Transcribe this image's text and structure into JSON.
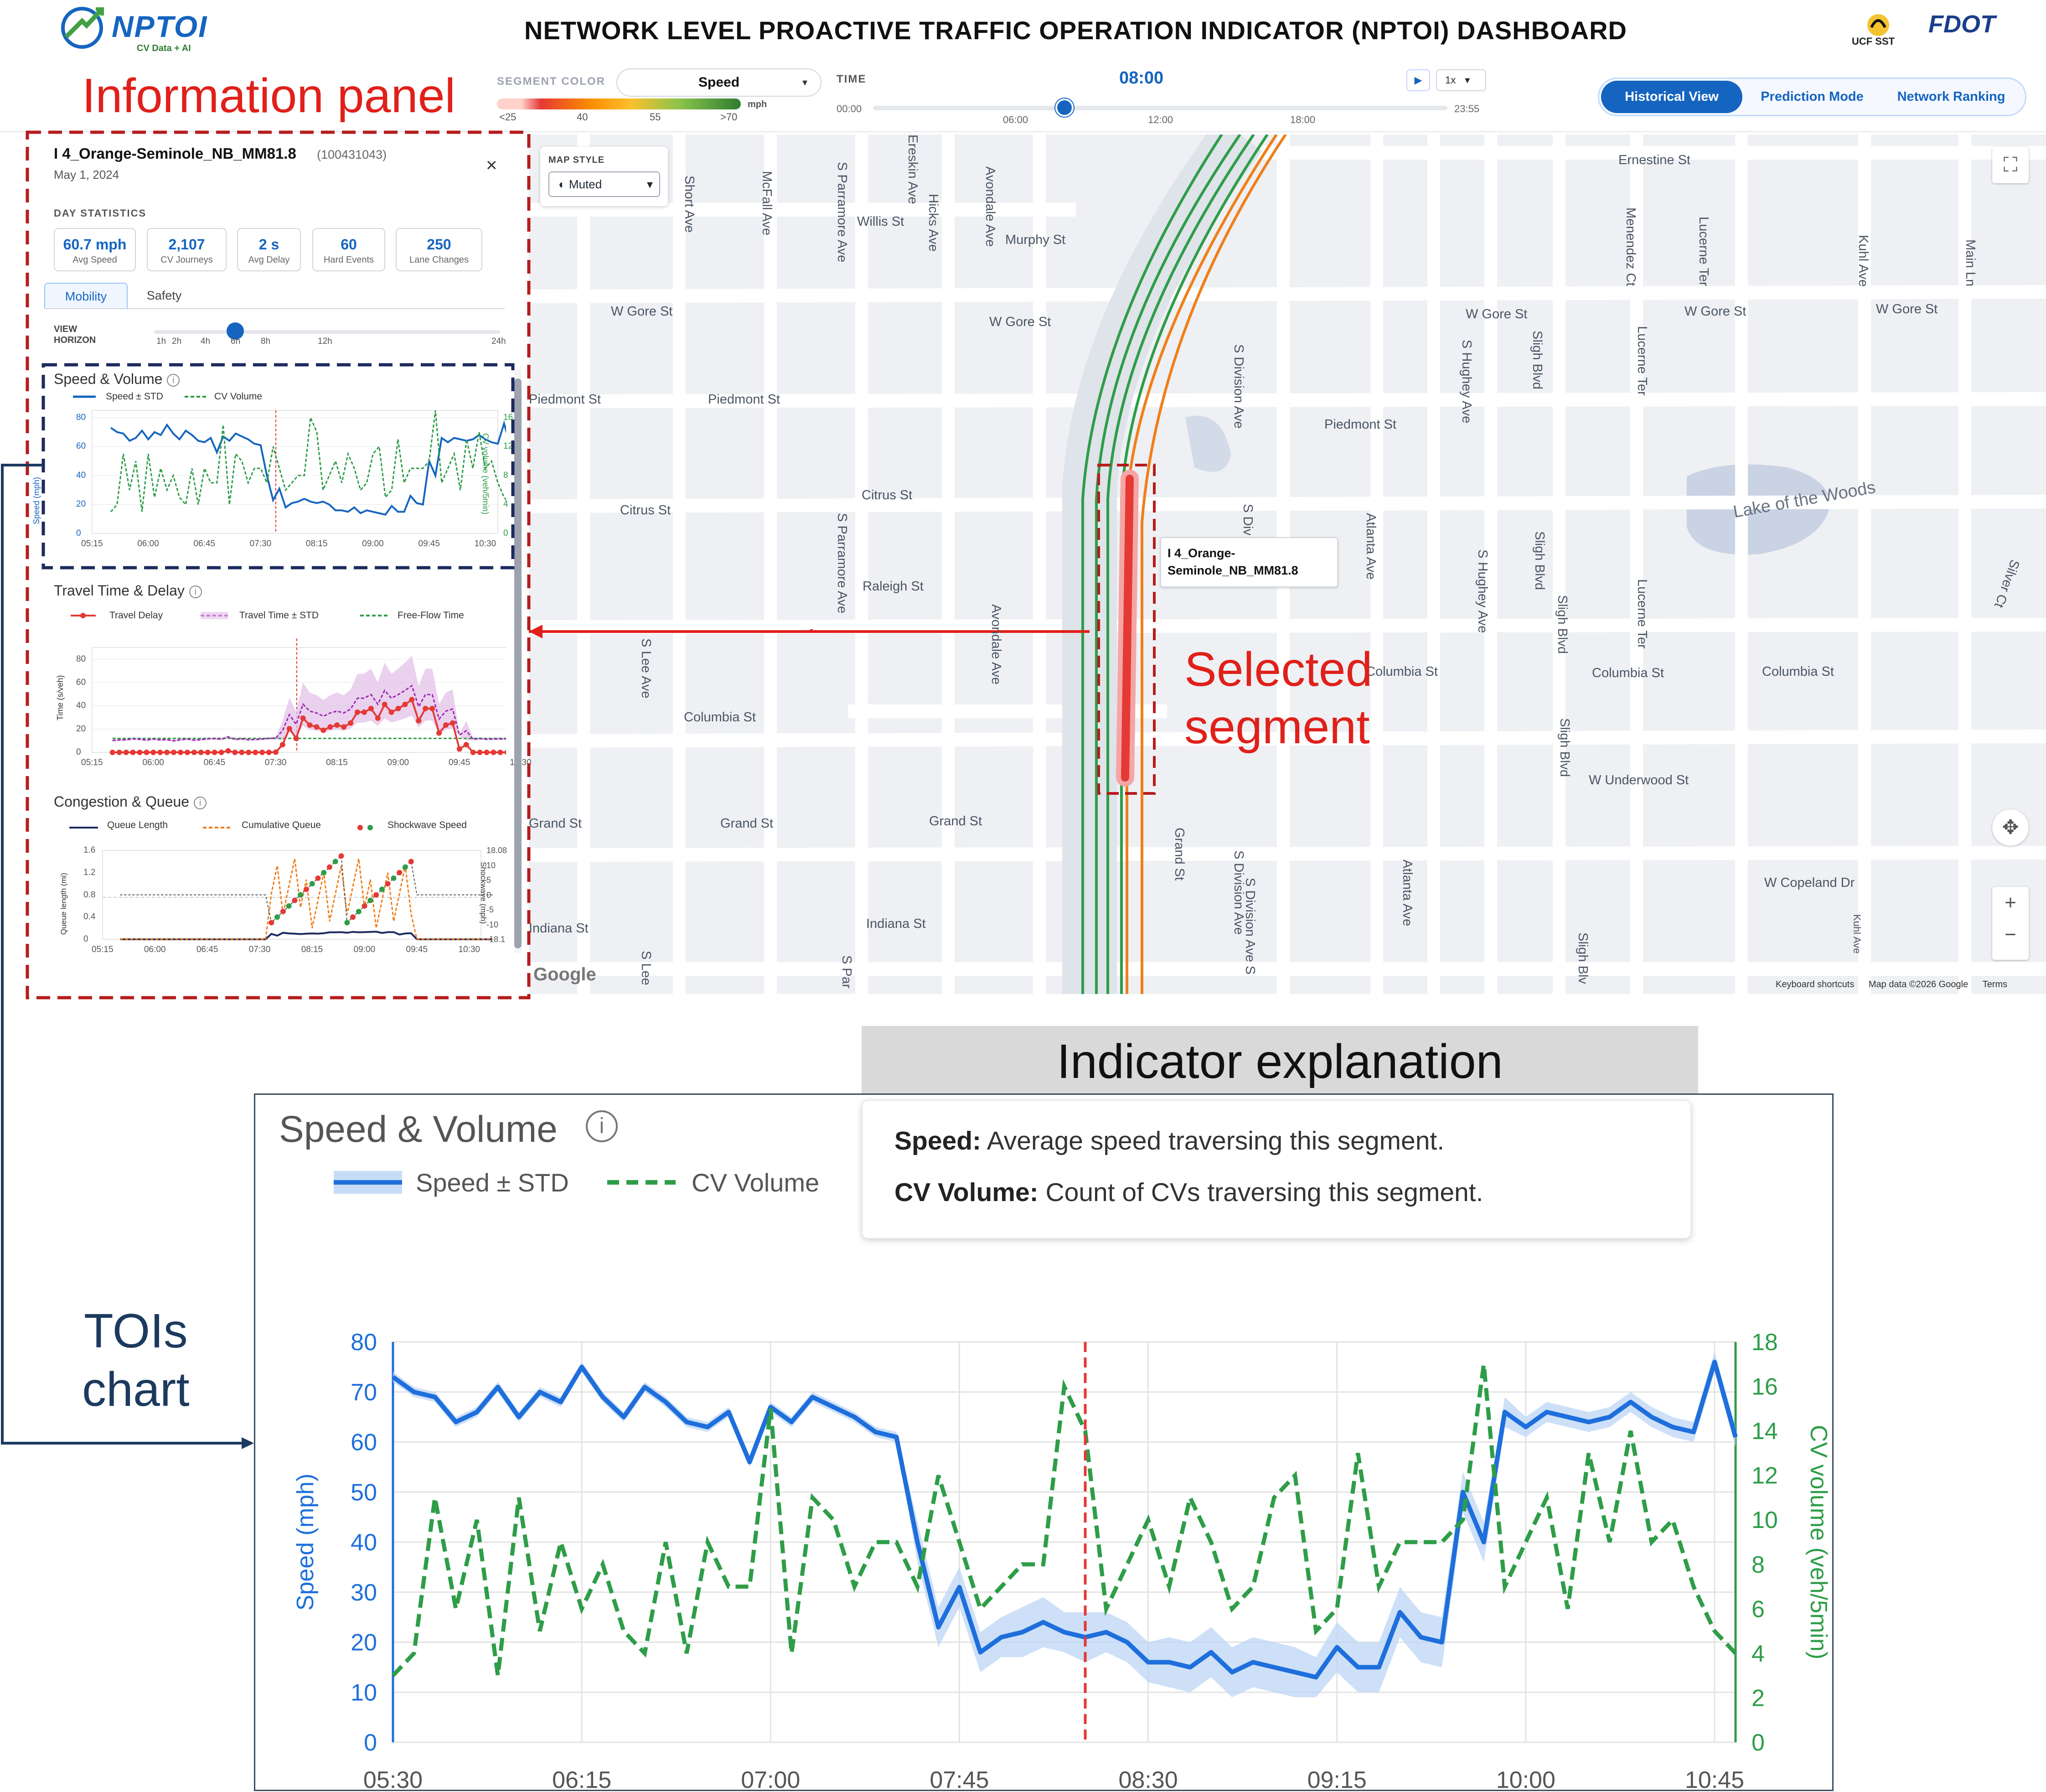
{
  "header": {
    "logo_text": "NPTOI",
    "logo_tagline": "CV Data + AI",
    "title": "NETWORK LEVEL PROACTIVE TRAFFIC OPERATION INDICATOR (NPTOI) DASHBOARD",
    "partner_ucf": "UCF SST",
    "partner_fdot": "FDOT"
  },
  "toolbar": {
    "segment_color_label": "SEGMENT COLOR",
    "segment_color_value": "Speed",
    "color_scale_ticks": [
      "<25",
      "40",
      "55",
      ">70"
    ],
    "color_scale_unit": "mph",
    "time_label": "TIME",
    "time_value": "08:00",
    "time_start": "00:00",
    "time_end": "23:55",
    "time_ticks": [
      "06:00",
      "12:00",
      "18:00"
    ],
    "time_progress": 0.333,
    "play_icon": "play-icon",
    "playback_speed": "1x",
    "modes": [
      "Historical View",
      "Prediction Mode",
      "Network Ranking"
    ],
    "active_mode": "Historical View"
  },
  "map": {
    "map_style_label": "MAP STYLE",
    "map_style_value": "◐ Muted",
    "streets": [
      "Ernestine St",
      "Short Ave",
      "McFall Ave",
      "S Parramore Ave",
      "Willis St",
      "Ereskin Ave",
      "Hicks Ave",
      "Avondale Ave",
      "Murphy St",
      "W Gore St",
      "W Gore St",
      "W Gore St",
      "W Gore St",
      "W Gore St",
      "Menendez Ct",
      "Lucerne Ter",
      "Kuhl Ave",
      "Main Ln",
      "Piedmont St",
      "Piedmont St",
      "Piedmont St",
      "S Division Ave",
      "S Hughey Ave",
      "Sligh Blvd",
      "Lucerne Ter",
      "Citrus St",
      "Citrus St",
      "Lake of the Woods",
      "S Parramore Ave",
      "Raleigh St",
      "Avondale Ave",
      "S Lee Ave",
      "S Hughey Ave",
      "Atlanta Ave",
      "Sligh Blvd",
      "Lucerne Ter",
      "Silver Ct",
      "Columbia St",
      "Columbia St",
      "Columbia St",
      "Columbia St",
      "Sligh Blvd",
      "W Underwood St",
      "Grand St",
      "Grand St",
      "Grand St",
      "Grand St",
      "W Copeland Dr",
      "Indiana St",
      "Indiana St",
      "S Lee",
      "S Par",
      "S Division Ave S",
      "Atlanta Ave",
      "Sligh Blv",
      "Kuhl Ave",
      "Sligh Blvd",
      "S Division Ave",
      "S Div"
    ],
    "selected_segment_tooltip": "I 4_Orange-Seminole_NB_MM81.8",
    "attribution": [
      "Keyboard shortcuts",
      "Map data ©2026 Google",
      "Terms"
    ],
    "google_logo": "Google"
  },
  "panel": {
    "segment_name": "I 4_Orange-Seminole_NB_MM81.8",
    "segment_id": "(100431043)",
    "date": "May 1, 2024",
    "day_statistics_label": "DAY STATISTICS",
    "stats": [
      {
        "value": "60.7 mph",
        "label": "Avg Speed"
      },
      {
        "value": "2,107",
        "label": "CV Journeys"
      },
      {
        "value": "2 s",
        "label": "Avg Delay"
      },
      {
        "value": "60",
        "label": "Hard Events"
      },
      {
        "value": "250",
        "label": "Lane Changes"
      }
    ],
    "tabs": [
      "Mobility",
      "Safety"
    ],
    "active_tab": "Mobility",
    "view_horizon_label": "VIEW HORIZON",
    "view_horizon_ticks": [
      "1h",
      "2h",
      "4h",
      "6h",
      "8h",
      "12h",
      "24h"
    ],
    "view_horizon_value": "6h"
  },
  "small_charts": {
    "speed_volume": {
      "title": "Speed & Volume",
      "legend": [
        "Speed ± STD",
        "CV Volume"
      ],
      "ylabel_left": "Speed (mph)",
      "ylabel_right": "CV volume (veh/5min)",
      "y_ticks_left": [
        "80",
        "60",
        "40",
        "20",
        "0"
      ],
      "y_ticks_right": [
        "16",
        "12",
        "8",
        "4",
        "0"
      ],
      "x_ticks": [
        "05:15",
        "06:00",
        "06:45",
        "07:30",
        "08:15",
        "09:00",
        "09:45",
        "10:30"
      ]
    },
    "travel_time": {
      "title": "Travel Time & Delay",
      "legend": [
        "Travel Delay",
        "Travel Time ± STD",
        "Free-Flow Time"
      ],
      "ylabel": "Time (s/veh)",
      "y_ticks": [
        "80",
        "60",
        "40",
        "20",
        "0"
      ],
      "x_ticks": [
        "05:15",
        "06:00",
        "06:45",
        "07:30",
        "08:15",
        "09:00",
        "09:45",
        "10:30"
      ]
    },
    "congestion": {
      "title": "Congestion & Queue",
      "legend": [
        "Queue Length",
        "Cumulative Queue",
        "Shockwave Speed"
      ],
      "ylabel_left": "Queue length (mi)",
      "ylabel_right": "Shockwave (mph)",
      "y_ticks_left": [
        "1.6",
        "1.2",
        "0.8",
        "0.4",
        "0"
      ],
      "y_ticks_right": [
        "18.08",
        "10",
        "5",
        "0",
        "-5",
        "-10",
        "-18.1"
      ],
      "x_ticks": [
        "05:15",
        "06:00",
        "06:45",
        "07:30",
        "08:15",
        "09:00",
        "09:45",
        "10:30"
      ]
    }
  },
  "annotations": {
    "information_panel": "Information panel",
    "selected_segment": [
      "Selected",
      "segment"
    ],
    "tois_chart": [
      "TOIs",
      "chart"
    ],
    "indicator_explanation": "Indicator explanation"
  },
  "big_chart": {
    "title": "Speed & Volume",
    "info_icon": "info-icon",
    "tooltip": [
      {
        "term": "Speed:",
        "text": " Average speed traversing this segment."
      },
      {
        "term": "CV Volume:",
        "text": " Count of CVs traversing this segment."
      }
    ]
  },
  "chart_data": {
    "type": "line",
    "title": "Speed & Volume",
    "xlabel": "",
    "ylabel": "Speed (mph)",
    "ylabel_right": "CV volume (veh/5min)",
    "x_ticks": [
      "05:30",
      "06:15",
      "07:00",
      "07:45",
      "08:30",
      "09:15",
      "10:00",
      "10:45"
    ],
    "x_range": [
      "05:30",
      "10:50"
    ],
    "ylim": [
      0,
      80
    ],
    "ylim_right": [
      0,
      18
    ],
    "y_ticks": [
      0,
      10,
      20,
      30,
      40,
      50,
      60,
      70,
      80
    ],
    "y_ticks_right": [
      0,
      2,
      4,
      6,
      8,
      10,
      12,
      14,
      16,
      18
    ],
    "current_time_marker": "08:15",
    "legend_placement": "top-left",
    "grid": true,
    "x": [
      "05:30",
      "05:35",
      "05:40",
      "05:45",
      "05:50",
      "05:55",
      "06:00",
      "06:05",
      "06:10",
      "06:15",
      "06:20",
      "06:25",
      "06:30",
      "06:35",
      "06:40",
      "06:45",
      "06:50",
      "06:55",
      "07:00",
      "07:05",
      "07:10",
      "07:15",
      "07:20",
      "07:25",
      "07:30",
      "07:35",
      "07:40",
      "07:45",
      "07:50",
      "07:55",
      "08:00",
      "08:05",
      "08:10",
      "08:15",
      "08:20",
      "08:25",
      "08:30",
      "08:35",
      "08:40",
      "08:45",
      "08:50",
      "08:55",
      "09:00",
      "09:05",
      "09:10",
      "09:15",
      "09:20",
      "09:25",
      "09:30",
      "09:35",
      "09:40",
      "09:45",
      "09:50",
      "09:55",
      "10:00",
      "10:05",
      "10:10",
      "10:15",
      "10:20",
      "10:25",
      "10:30",
      "10:35",
      "10:40",
      "10:45",
      "10:50"
    ],
    "series": [
      {
        "name": "Speed ± STD",
        "axis": "left",
        "values": [
          73,
          70,
          69,
          64,
          66,
          71,
          65,
          70,
          68,
          75,
          69,
          65,
          71,
          68,
          64,
          63,
          66,
          56,
          67,
          64,
          69,
          67,
          65,
          62,
          61,
          40,
          23,
          31,
          18,
          21,
          22,
          24,
          22,
          21,
          22,
          20,
          16,
          16,
          15,
          18,
          14,
          16,
          15,
          14,
          13,
          19,
          15,
          15,
          26,
          21,
          20,
          50,
          40,
          66,
          63,
          66,
          65,
          64,
          65,
          68,
          65,
          63,
          62,
          76,
          61
        ],
        "std": [
          1,
          1,
          1,
          1,
          1,
          1,
          1,
          1,
          1,
          1,
          1,
          1,
          1,
          1,
          1,
          1,
          1,
          1,
          1,
          1,
          1,
          1,
          1,
          1,
          1,
          4,
          4,
          4,
          4,
          4,
          5,
          5,
          4,
          5,
          4,
          4,
          4,
          5,
          5,
          5,
          5,
          5,
          5,
          5,
          4,
          5,
          5,
          5,
          5,
          5,
          5,
          4,
          4,
          3,
          2,
          2,
          2,
          2,
          2,
          2,
          2,
          2,
          2,
          2,
          2
        ]
      },
      {
        "name": "CV Volume",
        "axis": "right",
        "values": [
          3,
          4,
          11,
          6,
          10,
          3,
          11,
          5,
          9,
          6,
          8,
          5,
          4,
          9,
          4,
          9,
          7,
          7,
          15,
          4,
          11,
          10,
          7,
          9,
          9,
          7,
          12,
          9,
          6,
          7,
          8,
          8,
          16,
          14,
          6,
          8,
          10,
          7,
          11,
          9,
          6,
          7,
          11,
          12,
          5,
          6,
          13,
          7,
          9,
          9,
          9,
          10,
          17,
          7,
          9,
          11,
          6,
          13,
          9,
          14,
          9,
          10,
          7,
          5,
          4
        ]
      }
    ]
  }
}
